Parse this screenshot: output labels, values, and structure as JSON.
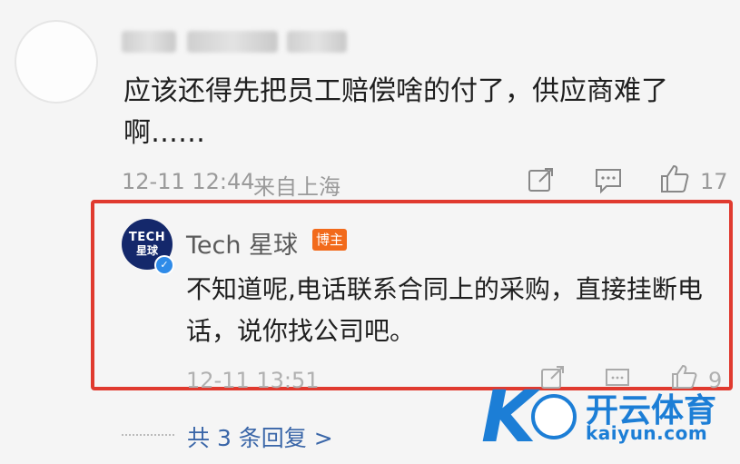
{
  "comment": {
    "text": "应该还得先把员工赔偿啥的付了，供应商难了啊……",
    "time": "12-11 12:44",
    "location": "来自上海",
    "like_count": "17"
  },
  "reply": {
    "author": "Tech 星球",
    "badge": "博主",
    "avatar_line1": "TECH",
    "avatar_line2": "星球",
    "text": "不知道呢,电话联系合同上的采购，直接挂断电话，说你找公司吧。",
    "time": "12-11 13:51",
    "like_count": "9"
  },
  "more_replies": "共 3 条回复 >",
  "watermark": {
    "cn": "开云体育",
    "en": "kaiyun.com"
  },
  "colors": {
    "highlight_border": "#e03a2f",
    "badge": "#f26a1b",
    "link": "#3a66a8",
    "watermark": "#1c7ed6"
  }
}
